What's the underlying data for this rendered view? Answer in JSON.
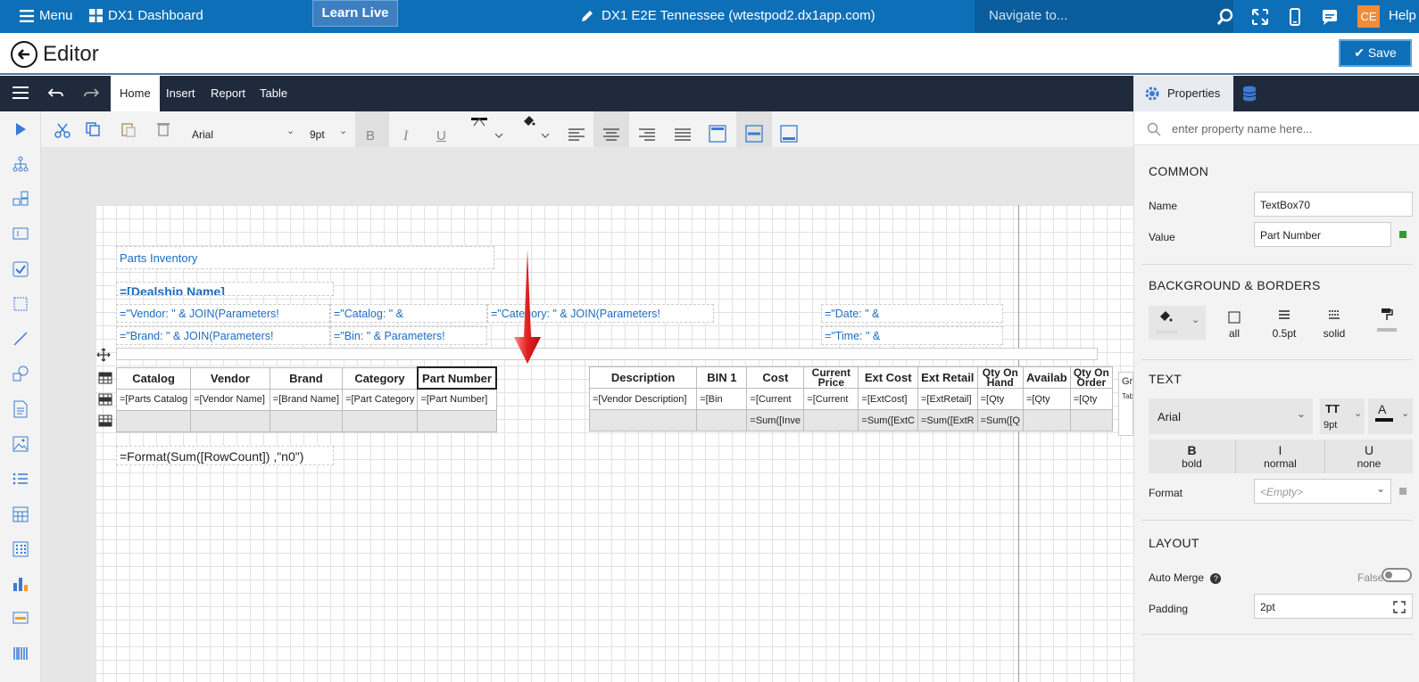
{
  "topbar": {
    "menu_label": "Menu",
    "dashboard_label": "DX1 Dashboard",
    "learn_live": "Learn Live",
    "app_title": "DX1 E2E Tennessee (wtestpod2.dx1app.com)",
    "navigate_placeholder": "Navigate to...",
    "user_initials": "CE",
    "help_label": "Help"
  },
  "editor": {
    "title": "Editor",
    "save_label": "Save"
  },
  "ribbon": {
    "tabs": [
      "Home",
      "Insert",
      "Report",
      "Table"
    ],
    "active_tab": "Home"
  },
  "toolbar": {
    "font_family": "Arial",
    "font_size": "9pt"
  },
  "report": {
    "title": "Parts Inventory",
    "dealership": "=[Dealship Name]",
    "vendor_expr": "=\"Vendor: \" & JOIN(Parameters!",
    "catalog_expr": "=\"Catalog: \" &",
    "category_expr": "=\"Category: \" & JOIN(Parameters!",
    "date_expr": "=\"Date: \" &",
    "brand_expr": "=\"Brand: \" & JOIN(Parameters!",
    "bin_expr": "=\"Bin: \" & Parameters!",
    "time_expr": "=\"Time: \" &",
    "row_count_expr": "=Format(Sum([RowCount]) ,\"n0\")",
    "side_fragment_1": "Gr",
    "side_fragment_2": "Tab"
  },
  "table": {
    "headers_left": [
      "Catalog",
      "Vendor",
      "Brand",
      "Category",
      "Part Number"
    ],
    "headers_right": [
      "Description",
      "BIN 1",
      "Cost",
      "Current Price",
      "Ext Cost",
      "Ext Retail",
      "Qty On Hand",
      "Availab",
      "Qty On Order"
    ],
    "detail_left": [
      "=[Parts Catalog",
      "=[Vendor Name]",
      "=[Brand Name]",
      "=[Part Category",
      "=[Part Number]"
    ],
    "detail_right": [
      "=[Vendor Description]",
      "=[Bin",
      "=[Current",
      "=[Current",
      "=[ExtCost]",
      "=[ExtRetail]",
      "=[Qty",
      "=[Qty",
      "=[Qty"
    ],
    "footer_right": [
      "",
      "",
      "=Sum([Inve",
      "",
      "=Sum([ExtC",
      "=Sum([ExtR",
      "=Sum([Q",
      "",
      ""
    ]
  },
  "properties": {
    "tab_label": "Properties",
    "search_placeholder": "enter property name here...",
    "common_title": "COMMON",
    "name_label": "Name",
    "name_value": "TextBox70",
    "value_label": "Value",
    "value_value": "Part Number",
    "bg_title": "BACKGROUND & BORDERS",
    "border_all": "all",
    "border_width": "0.5pt",
    "border_style": "solid",
    "text_title": "TEXT",
    "font_family": "Arial",
    "font_size": "9pt",
    "bold_label": "bold",
    "italic_label": "normal",
    "underline_label": "none",
    "format_label": "Format",
    "format_placeholder": "<Empty>",
    "layout_title": "LAYOUT",
    "automerge_label": "Auto Merge",
    "automerge_value": "False",
    "padding_label": "Padding",
    "padding_value": "2pt"
  },
  "colors": {
    "topbar": "#0d6fb8",
    "ribbon": "#1f2a3d",
    "accent": "#1d6cc0",
    "arrow": "#e02020"
  }
}
